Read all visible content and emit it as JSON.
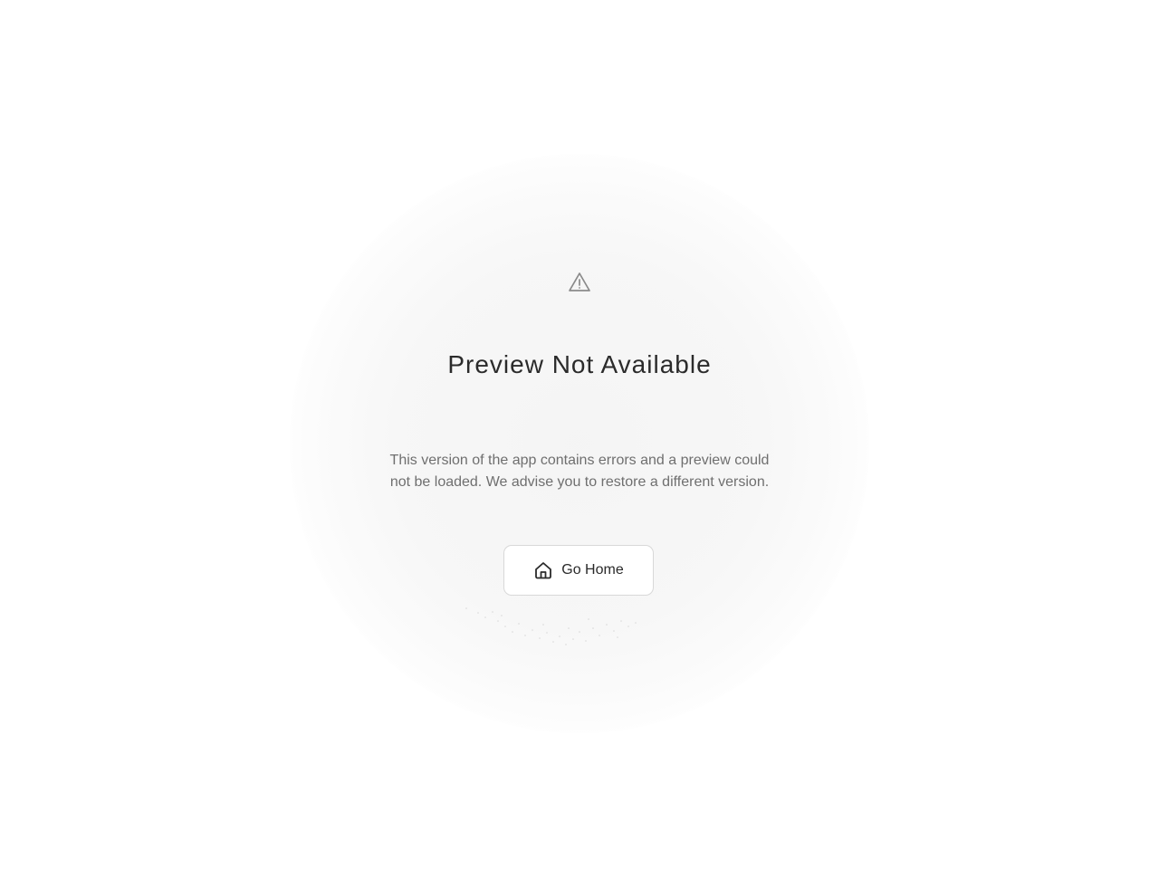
{
  "error_page": {
    "title": "Preview Not Available",
    "message": "This version of the app contains errors and a preview could not be loaded. We advise you to restore a different version.",
    "icon": "warning-triangle-icon",
    "home_button": {
      "label": "Go Home",
      "icon": "home-icon"
    }
  },
  "colors": {
    "title": "#2b2b2b",
    "message": "#6f6f6f",
    "icon": "#8a8a8a",
    "button_border": "#d8d8d8"
  }
}
